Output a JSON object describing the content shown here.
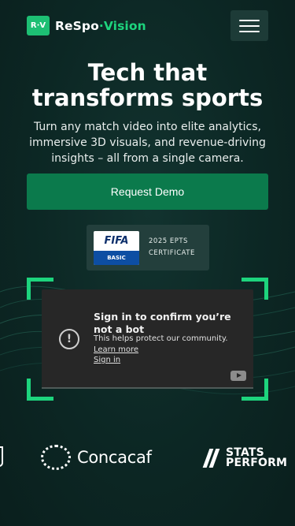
{
  "header": {
    "logo_badge": "R·V",
    "logo_name_part1": "ReSpo",
    "logo_dot": "·",
    "logo_name_part2": "Vision"
  },
  "hero": {
    "title_line1": "Tech that",
    "title_line2": "transforms sports",
    "subtitle": "Turn any match video into elite analytics, immersive 3D visuals, and revenue-driving insights – all from a single camera.",
    "cta_label": "Request Demo"
  },
  "certificate": {
    "logo_top": "FIFA",
    "logo_bottom": "BASIC",
    "line1": "2025 EPTS",
    "line2": "CERTIFICATE"
  },
  "video": {
    "title": "Sign in to confirm you’re not a bot",
    "subtitle": "This helps protect our community.",
    "learn_more": "Learn more",
    "sign_in": "Sign in"
  },
  "partners": {
    "concacaf": "Concacaf",
    "stats_line1": "STATS",
    "stats_line2": "PERFORM"
  },
  "colors": {
    "accent": "#1dd47d",
    "cta_bg": "#0b7a4c",
    "background": "#0d2b28"
  }
}
